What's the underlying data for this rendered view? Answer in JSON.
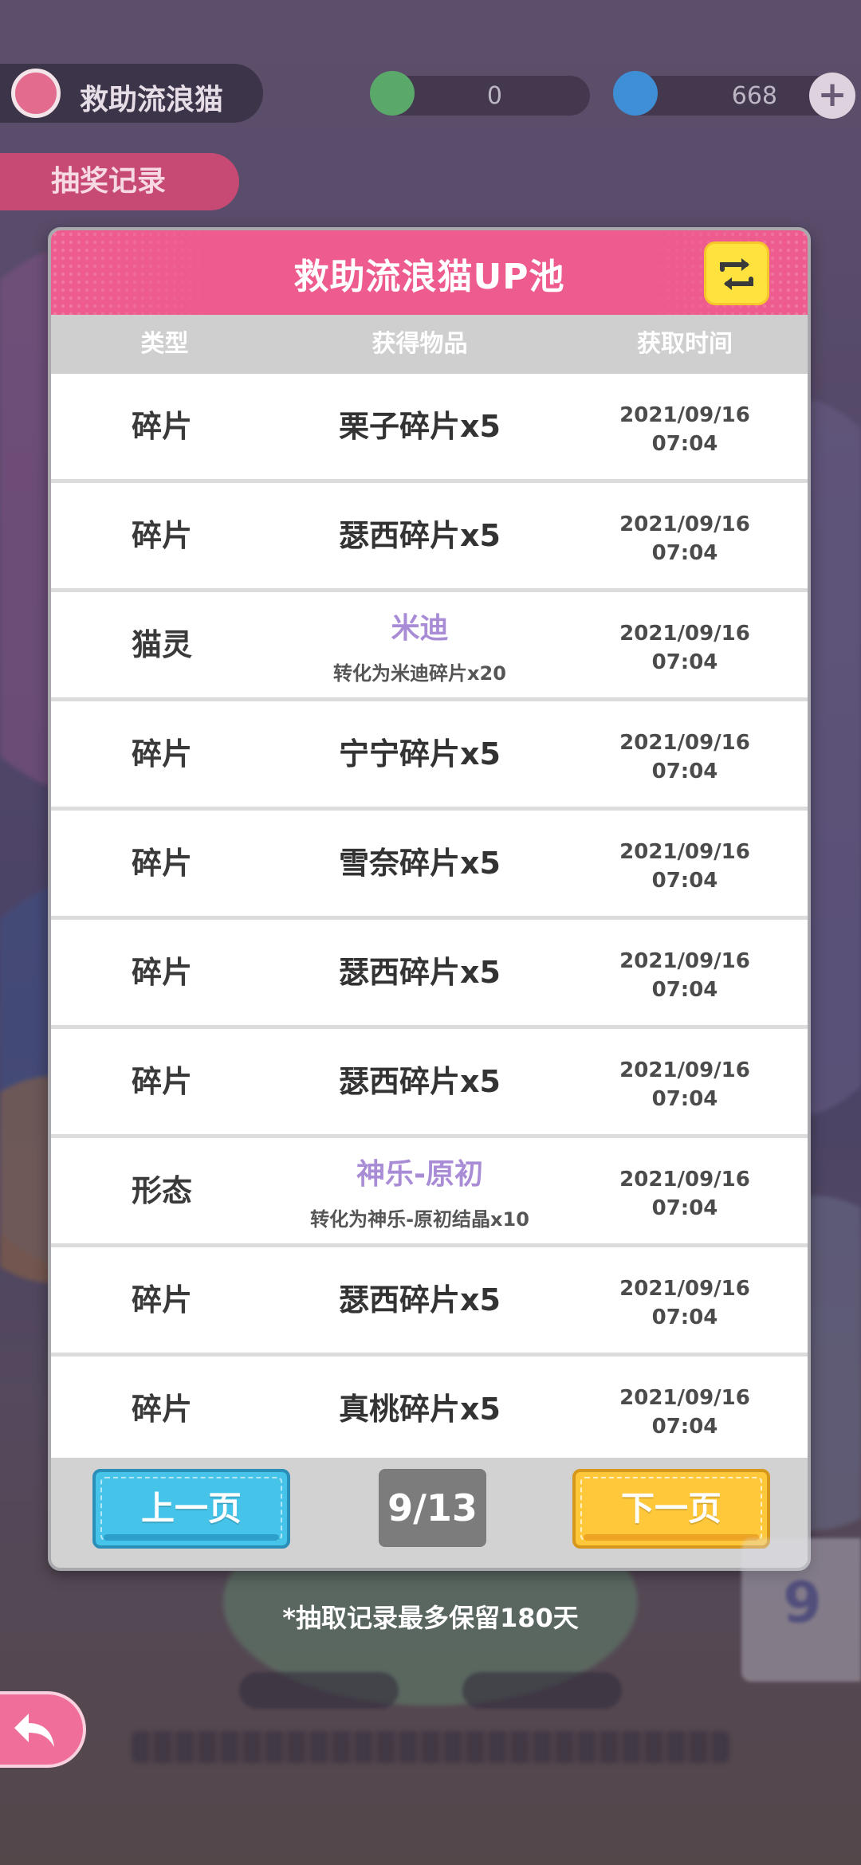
{
  "hud": {
    "title": "救助流浪猫",
    "resource_1_value": "0",
    "resource_2_value": "668",
    "draw_record_tab": "抽奖记录"
  },
  "dialog": {
    "title": "救助流浪猫UP池",
    "columns": {
      "type": "类型",
      "item": "获得物品",
      "time": "获取时间"
    },
    "rows": [
      {
        "type": "碎片",
        "item": "栗子碎片x5",
        "date": "2021/09/16",
        "time": "07:04"
      },
      {
        "type": "碎片",
        "item": "瑟西碎片x5",
        "date": "2021/09/16",
        "time": "07:04"
      },
      {
        "type": "猫灵",
        "item": "米迪",
        "note": "转化为米迪碎片x20",
        "date": "2021/09/16",
        "time": "07:04"
      },
      {
        "type": "碎片",
        "item": "宁宁碎片x5",
        "date": "2021/09/16",
        "time": "07:04"
      },
      {
        "type": "碎片",
        "item": "雪奈碎片x5",
        "date": "2021/09/16",
        "time": "07:04"
      },
      {
        "type": "碎片",
        "item": "瑟西碎片x5",
        "date": "2021/09/16",
        "time": "07:04"
      },
      {
        "type": "碎片",
        "item": "瑟西碎片x5",
        "date": "2021/09/16",
        "time": "07:04"
      },
      {
        "type": "形态",
        "item": "神乐-原初",
        "note": "转化为神乐-原初结晶x10",
        "date": "2021/09/16",
        "time": "07:04"
      },
      {
        "type": "碎片",
        "item": "瑟西碎片x5",
        "date": "2021/09/16",
        "time": "07:04"
      },
      {
        "type": "碎片",
        "item": "真桃碎片x5",
        "date": "2021/09/16",
        "time": "07:04"
      }
    ],
    "footer": {
      "prev_label": "上一页",
      "page_indicator": "9/13",
      "next_label": "下一页"
    }
  },
  "retention_note": "*抽取记录最多保留180天",
  "side_card": {
    "value": "9"
  },
  "icons": {
    "switch": "switch-arrows-icon",
    "back": "back-arrow-icon"
  },
  "colors": {
    "header_pink": "#ee5b8e",
    "special_item_purple": "#a98cd6",
    "prev_blue": "#45c3e8",
    "next_yellow": "#ffc83a",
    "switch_yellow": "#ffe23d"
  }
}
